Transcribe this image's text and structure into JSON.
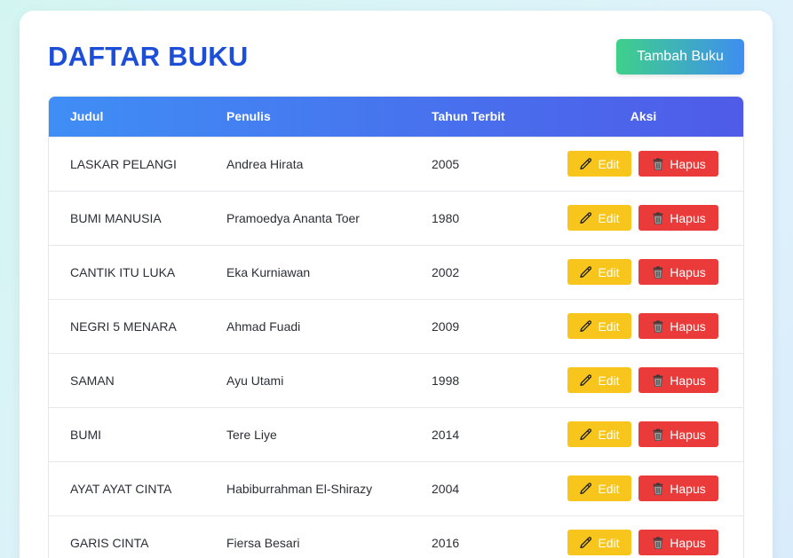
{
  "page": {
    "title": "DAFTAR BUKU",
    "add_button": "Tambah Buku"
  },
  "table": {
    "headers": [
      "Judul",
      "Penulis",
      "Tahun Terbit",
      "Aksi"
    ],
    "edit_label": "Edit",
    "delete_label": "Hapus",
    "rows": [
      {
        "judul": "LASKAR PELANGI",
        "penulis": "Andrea Hirata",
        "tahun": "2005"
      },
      {
        "judul": "BUMI MANUSIA",
        "penulis": "Pramoedya Ananta Toer",
        "tahun": "1980"
      },
      {
        "judul": "CANTIK ITU LUKA",
        "penulis": "Eka Kurniawan",
        "tahun": "2002"
      },
      {
        "judul": "NEGRI 5 MENARA",
        "penulis": "Ahmad Fuadi",
        "tahun": "2009"
      },
      {
        "judul": "SAMAN",
        "penulis": "Ayu Utami",
        "tahun": "1998"
      },
      {
        "judul": "BUMI",
        "penulis": "Tere Liye",
        "tahun": "2014"
      },
      {
        "judul": "AYAT AYAT CINTA",
        "penulis": "Habiburrahman El-Shirazy",
        "tahun": "2004"
      },
      {
        "judul": "GARIS CINTA",
        "penulis": "Fiersa Besari",
        "tahun": "2016"
      }
    ]
  },
  "icons": {
    "edit": "pencil-icon",
    "delete": "trash-icon"
  },
  "colors": {
    "title": "#1d4ed8",
    "edit_button": "#f7c51c",
    "delete_button": "#ea3a3a",
    "header_gradient_start": "#3f8ef5",
    "header_gradient_end": "#4f5be8"
  }
}
